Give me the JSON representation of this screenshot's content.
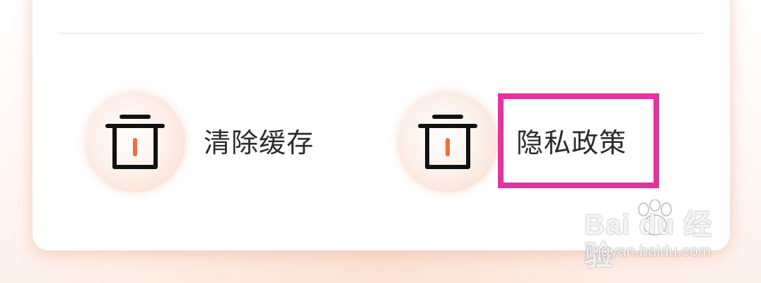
{
  "menu": {
    "items": [
      {
        "label": "清除缓存",
        "icon": "trash-icon"
      },
      {
        "label": "隐私政策",
        "icon": "trash-icon"
      }
    ]
  },
  "watermark": {
    "brand": "Bai du 经验",
    "url": "jingyan.baidu.com"
  },
  "colors": {
    "icon_stroke": "#111111",
    "icon_accent": "#f0703a",
    "highlight": "#e4329e",
    "card_background": "#ffffff"
  }
}
